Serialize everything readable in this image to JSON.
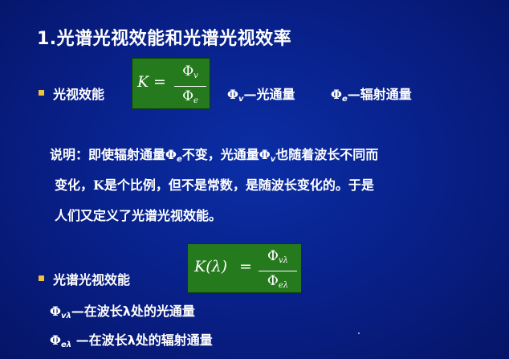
{
  "title": "1.光谱光视效能和光谱光视效率",
  "item1": {
    "label": "光视效能",
    "formula_k": "K",
    "formula_eq": "=",
    "formula_num": "Φv",
    "formula_den": "Φe",
    "def1_sym": "Φ",
    "def1_sub": "v",
    "def1_text": "—光通量",
    "def2_sym": "Φ",
    "def2_sub": "e",
    "def2_text": "—辐射通量"
  },
  "explanation": {
    "line1_a": "说明：即使辐射通量",
    "line1_sym1": "Φ",
    "line1_sub1": "e",
    "line1_b": "不变，光通量",
    "line1_sym2": "Φ",
    "line1_sub2": "v",
    "line1_c": "也随着波长不同而",
    "line2_a": "变化，",
    "line2_k": "K",
    "line2_b": "是个比例，但不是常数，是随波长变化的。于是",
    "line3": "人们又定义了光谱光视效能。"
  },
  "item2": {
    "label": "光谱光视效能",
    "formula_lhs": "K(λ)",
    "formula_eq": "=",
    "formula_num": "Φvλ",
    "formula_den": "Φeλ",
    "def1_sym": "Φ",
    "def1_sub": "vλ",
    "def1_text": "—在波长λ处的光通量",
    "def2_sym": "Φ",
    "def2_sub": "eλ",
    "def2_text": " —在波长λ处的辐射通量"
  },
  "colors": {
    "background": "#081f86",
    "bullet": "#f0c23a",
    "formula_box": "#267a1e",
    "text": "#ffffff"
  }
}
